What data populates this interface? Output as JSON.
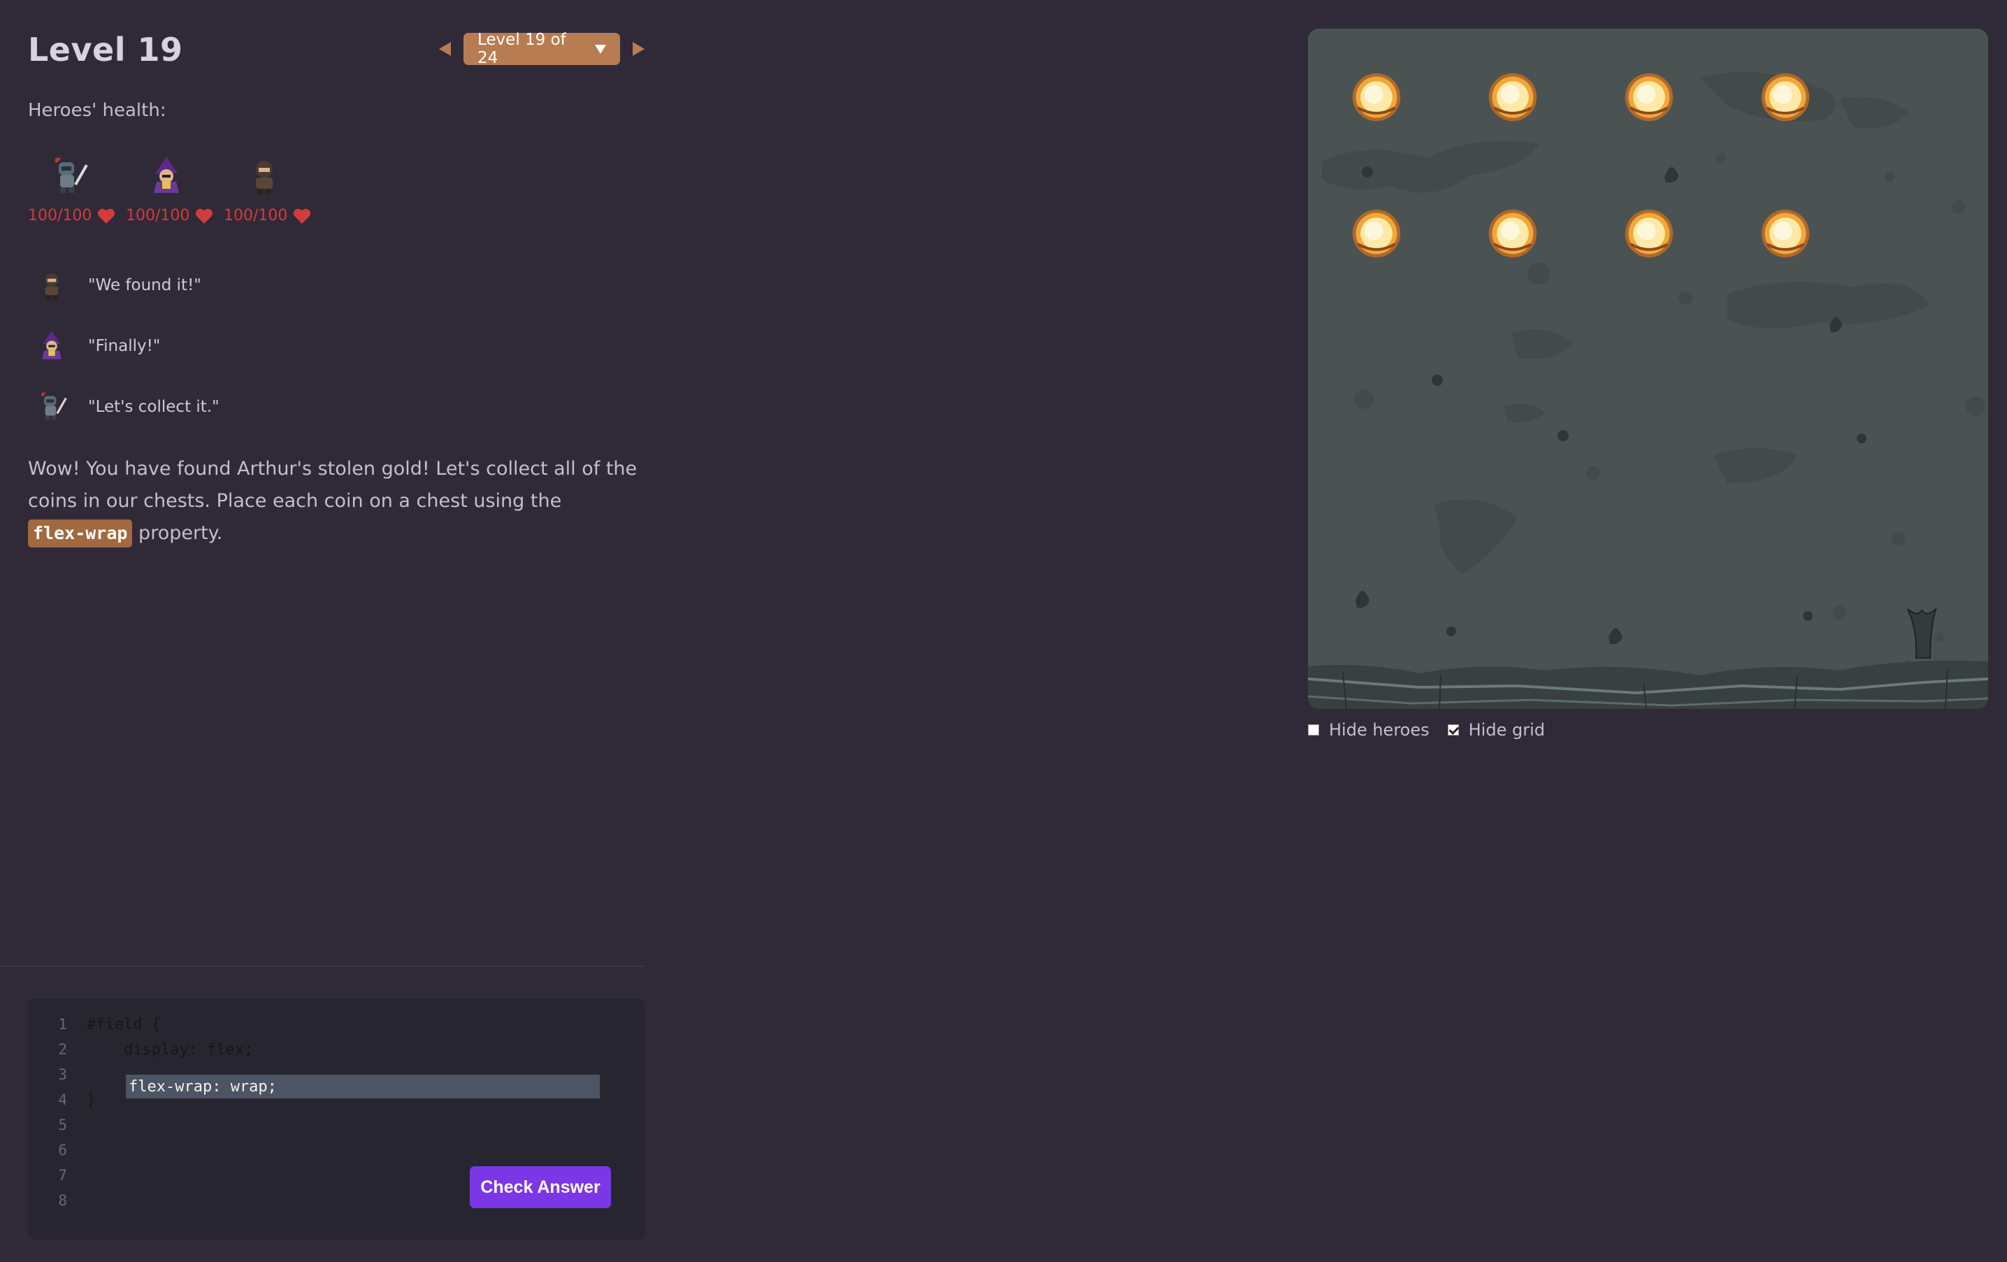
{
  "level": {
    "title": "Level 19",
    "selector_label": "Level 19 of 24",
    "prev_icon": "triangle-left-icon",
    "next_icon": "triangle-right-icon"
  },
  "health": {
    "label": "Heroes' health:",
    "heroes": [
      {
        "name": "knight",
        "hp": "100/100",
        "icon": "knight-hero-icon"
      },
      {
        "name": "wizard",
        "hp": "100/100",
        "icon": "wizard-hero-icon"
      },
      {
        "name": "rogue",
        "hp": "100/100",
        "icon": "rogue-hero-icon"
      }
    ],
    "heart_color": "#d23c3c"
  },
  "dialogue": [
    {
      "speaker": "rogue",
      "text": "\"We found it!\""
    },
    {
      "speaker": "wizard",
      "text": "\"Finally!\""
    },
    {
      "speaker": "knight",
      "text": "\"Let's collect it.\""
    }
  ],
  "instructions": {
    "before": "Wow! You have found Arthur's stolen gold! Let's collect all of the coins in our chests. Place each coin on a chest using the ",
    "code": "flex-wrap",
    "after": " property."
  },
  "editor": {
    "line_numbers": [
      "1",
      "2",
      "3",
      "4",
      "5",
      "6",
      "7",
      "8"
    ],
    "lines": [
      "#field {",
      "    display: flex;",
      "",
      "}",
      "",
      "",
      "",
      ""
    ],
    "input_value": "flex-wrap: wrap;",
    "check_button": "Check Answer"
  },
  "board": {
    "coin_count": 8,
    "coin_icon": "gold-coin-icon",
    "ground_icon": "dead-tree-icon"
  },
  "options": {
    "hide_heroes": {
      "label": "Hide heroes",
      "checked": false
    },
    "hide_grid": {
      "label": "Hide grid",
      "checked": true
    }
  },
  "colors": {
    "background": "#302937",
    "accent": "#b87c52",
    "button": "#7b37e6",
    "board": "#4a5352"
  }
}
